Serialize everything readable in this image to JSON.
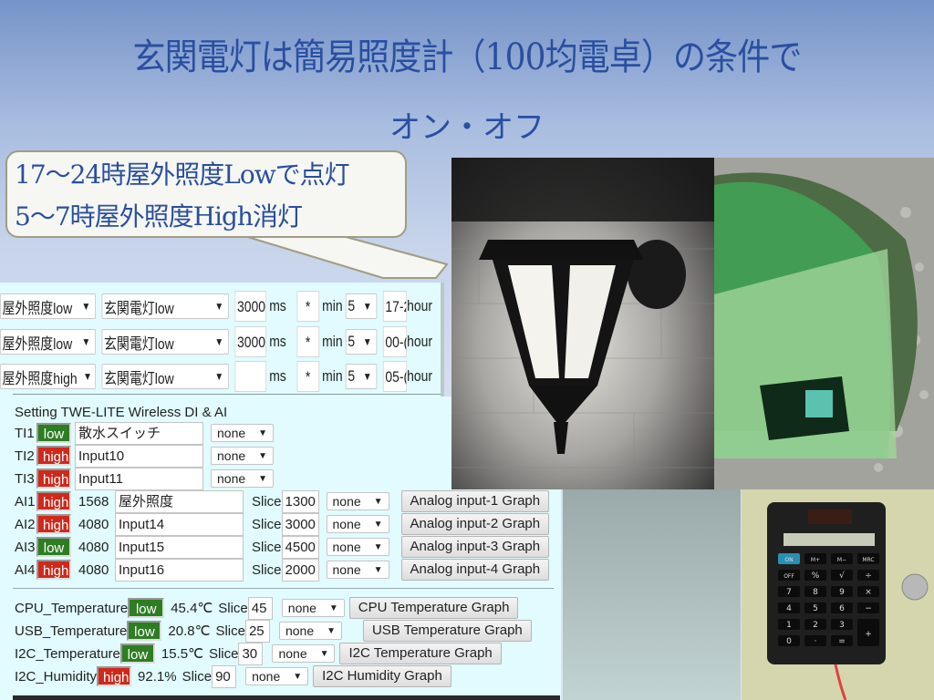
{
  "slide": {
    "title": "玄関電灯は簡易照度計（100均電卓）の条件で",
    "subtitle": "オン・オフ"
  },
  "callout": {
    "line1": "17〜24時屋外照度Lowで点灯",
    "line2": "5〜7時屋外照度High消灯"
  },
  "rules": [
    {
      "condition": "屋外照度low",
      "device": "玄関電灯low",
      "ms_value": "3000(",
      "ms_label": "ms",
      "star": "*",
      "min_label": "min",
      "min_value": "5",
      "hour_value": "17-2",
      "hour_label": "hour"
    },
    {
      "condition": "屋外照度low",
      "device": "玄関電灯low",
      "ms_value": "3000(",
      "ms_label": "ms",
      "star": "*",
      "min_label": "min",
      "min_value": "5",
      "hour_value": "00-(",
      "hour_label": "hour"
    },
    {
      "condition": "屋外照度high",
      "device": "玄関電灯low",
      "ms_value": "",
      "ms_label": "ms",
      "star": "*",
      "min_label": "min",
      "min_value": "5",
      "hour_value": "05-(",
      "hour_label": "hour"
    }
  ],
  "settings": {
    "heading": "Setting TWE-LITE Wireless DI & AI",
    "digital_inputs": [
      {
        "label": "TI1",
        "state": "low",
        "name": "散水スイッチ",
        "option": "none"
      },
      {
        "label": "TI2",
        "state": "high",
        "name": "Input10",
        "option": "none"
      },
      {
        "label": "TI3",
        "state": "high",
        "name": "Input11",
        "option": "none"
      }
    ],
    "analog_inputs": [
      {
        "label": "AI1",
        "state": "high",
        "value": "1568",
        "name": "屋外照度",
        "slice_label": "Slice",
        "slice": "1300",
        "option": "none",
        "graph_button": "Analog input-1 Graph"
      },
      {
        "label": "AI2",
        "state": "high",
        "value": "4080",
        "name": "Input14",
        "slice_label": "Slice",
        "slice": "3000",
        "option": "none",
        "graph_button": "Analog input-2 Graph"
      },
      {
        "label": "AI3",
        "state": "low",
        "value": "4080",
        "name": "Input15",
        "slice_label": "Slice",
        "slice": "4500",
        "option": "none",
        "graph_button": "Analog input-3 Graph"
      },
      {
        "label": "AI4",
        "state": "high",
        "value": "4080",
        "name": "Input16",
        "slice_label": "Slice",
        "slice": "2000",
        "option": "none",
        "graph_button": "Analog input-4 Graph"
      }
    ],
    "sensors": [
      {
        "label": "CPU_Temperature",
        "state": "low",
        "value": "45.4℃",
        "slice_label": "Slice",
        "slice": "45",
        "option": "none",
        "graph_button": "CPU Temperature Graph"
      },
      {
        "label": "USB_Temperature",
        "state": "low",
        "value": "20.8℃",
        "slice_label": "Slice",
        "slice": "25",
        "option": "none",
        "graph_button": "USB Temperature Graph"
      },
      {
        "label": "I2C_Temperature",
        "state": "low",
        "value": "15.5℃",
        "slice_label": "Slice",
        "slice": "30",
        "option": "none",
        "graph_button": "I2C Temperature Graph"
      },
      {
        "label": "I2C_Humidity",
        "state": "high",
        "value": "92.1%",
        "slice_label": "Slice",
        "slice": "90",
        "option": "none",
        "graph_button": "I2C Humidity Graph"
      }
    ]
  },
  "photos": {
    "lamp": "porch-lamp-photo",
    "sensor": "wrapped-calculator-sensor-photo",
    "calculator": "calculator-photo",
    "calculator_keys": [
      [
        "ON",
        "M+",
        "M−",
        "MRC"
      ],
      [
        "OFF",
        "%",
        "√",
        "÷"
      ],
      [
        "7",
        "8",
        "9",
        "×"
      ],
      [
        "4",
        "5",
        "6",
        "−"
      ],
      [
        "1",
        "2",
        "3",
        "+"
      ],
      [
        "0",
        "·",
        "="
      ]
    ]
  },
  "colors": {
    "title": "#2a4fa0",
    "low": "#2e7d23",
    "high": "#d0291b",
    "panel": "#e1fbfe"
  }
}
